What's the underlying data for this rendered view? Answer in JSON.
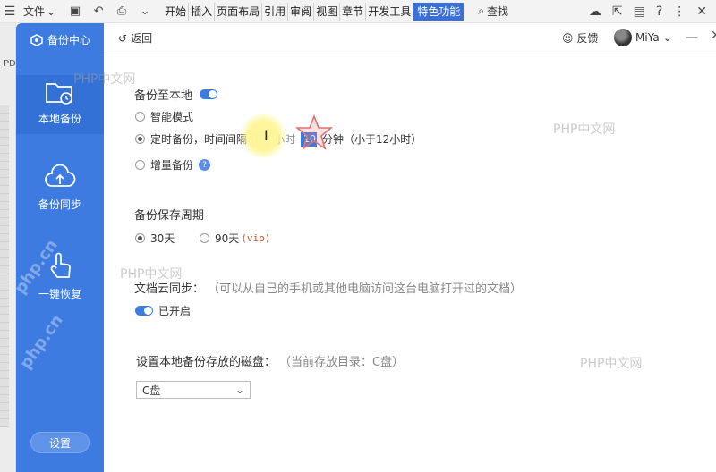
{
  "ribbon": {
    "file_label": "文件",
    "tabs": [
      "开始",
      "插入",
      "页面布局",
      "引用",
      "审阅",
      "视图",
      "章节",
      "开发工具",
      "特色功能"
    ],
    "active_tab": "特色功能",
    "search_label": "查找"
  },
  "doc": {
    "pd_label": "PD"
  },
  "sidebar": {
    "brand": "备份中心",
    "items": [
      {
        "label": "本地备份"
      },
      {
        "label": "备份同步"
      },
      {
        "label": "一键恢复"
      }
    ],
    "settings": "设置"
  },
  "topbar": {
    "back": "返回",
    "feedback": "反馈",
    "user": "MiYa"
  },
  "backup_local": {
    "title": "备份至本地",
    "enabled": true,
    "smart_mode": "智能模式",
    "timed_prefix": "定时备份，时间间隔",
    "hours_value": "0",
    "hours_unit": "小时",
    "minutes_value": "10",
    "minutes_unit": "分钟（小于12小时）",
    "incremental": "增量备份",
    "help_glyph": "?"
  },
  "retention": {
    "title": "备份保存周期",
    "opt30": "30天",
    "opt90": "90天",
    "vip": "(vip)"
  },
  "cloud_sync": {
    "title": "文档云同步：",
    "desc": "（可以从自己的手机或其他电脑访问这台电脑打开过的文档）",
    "status": "已开启"
  },
  "disk": {
    "title": "设置本地备份存放的磁盘：",
    "current": "（当前存放目录：C盘）",
    "selected": "C盘"
  },
  "watermarks": {
    "text": "PHP中文网",
    "rotated": "php.cn"
  },
  "colors": {
    "accent": "#3d7be0",
    "ribbon_active": "#3b6fd8"
  }
}
